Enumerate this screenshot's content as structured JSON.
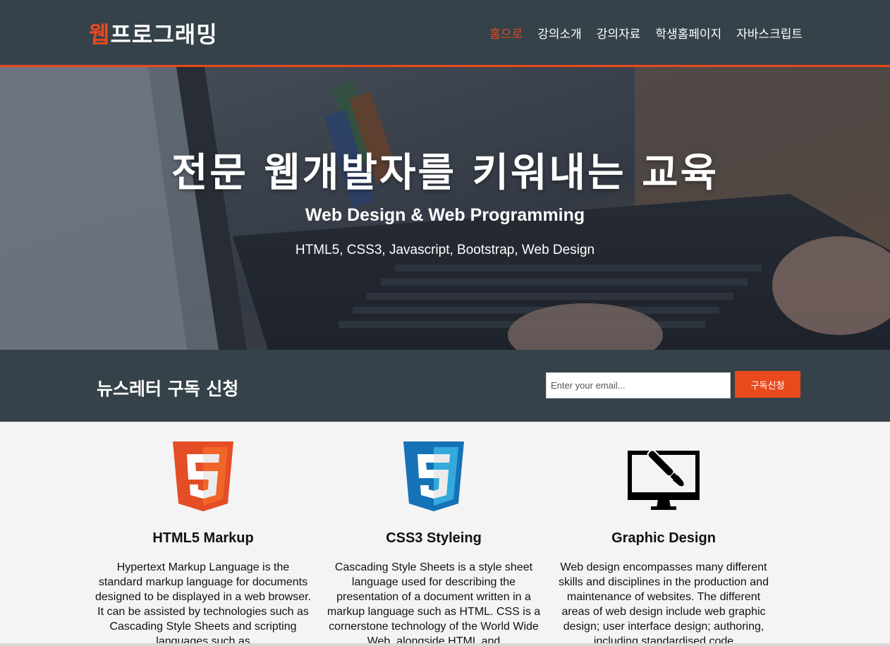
{
  "header": {
    "logo_accent": "웹",
    "logo_rest": "프로그래밍",
    "nav": [
      {
        "label": "홈으로",
        "active": true
      },
      {
        "label": "강의소개",
        "active": false
      },
      {
        "label": "강의자료",
        "active": false
      },
      {
        "label": "학생홈페이지",
        "active": false
      },
      {
        "label": "자바스크립트",
        "active": false
      }
    ]
  },
  "hero": {
    "title": "전문 웹개발자를 키워내는 교육",
    "subtitle": "Web Design & Web Programming",
    "topics": "HTML5, CSS3, Javascript, Bootstrap, Web Design"
  },
  "newsletter": {
    "title": "뉴스레터 구독 신청",
    "email_placeholder": "Enter your email...",
    "button_label": "구독신청"
  },
  "boxes": [
    {
      "icon": "html5-logo-icon",
      "title": "HTML5 Markup",
      "text": "Hypertext Markup Language is the standard markup language for documents designed to be displayed in a web browser. It can be assisted by technologies such as Cascading Style Sheets and scripting languages such as"
    },
    {
      "icon": "css3-logo-icon",
      "title": "CSS3 Styleing",
      "text": "Cascading Style Sheets is a style sheet language used for describing the presentation of a document written in a markup language such as HTML. CSS is a cornerstone technology of the World Wide Web, alongside HTML and"
    },
    {
      "icon": "monitor-brush-icon",
      "title": "Graphic Design",
      "text": "Web design encompasses many different skills and disciplines in the production and maintenance of websites. The different areas of web design include web graphic design; user interface design; authoring, including standardised code"
    }
  ],
  "colors": {
    "header_bg": "#35424a",
    "accent": "#e8491d",
    "page_bg": "#f4f4f4"
  }
}
